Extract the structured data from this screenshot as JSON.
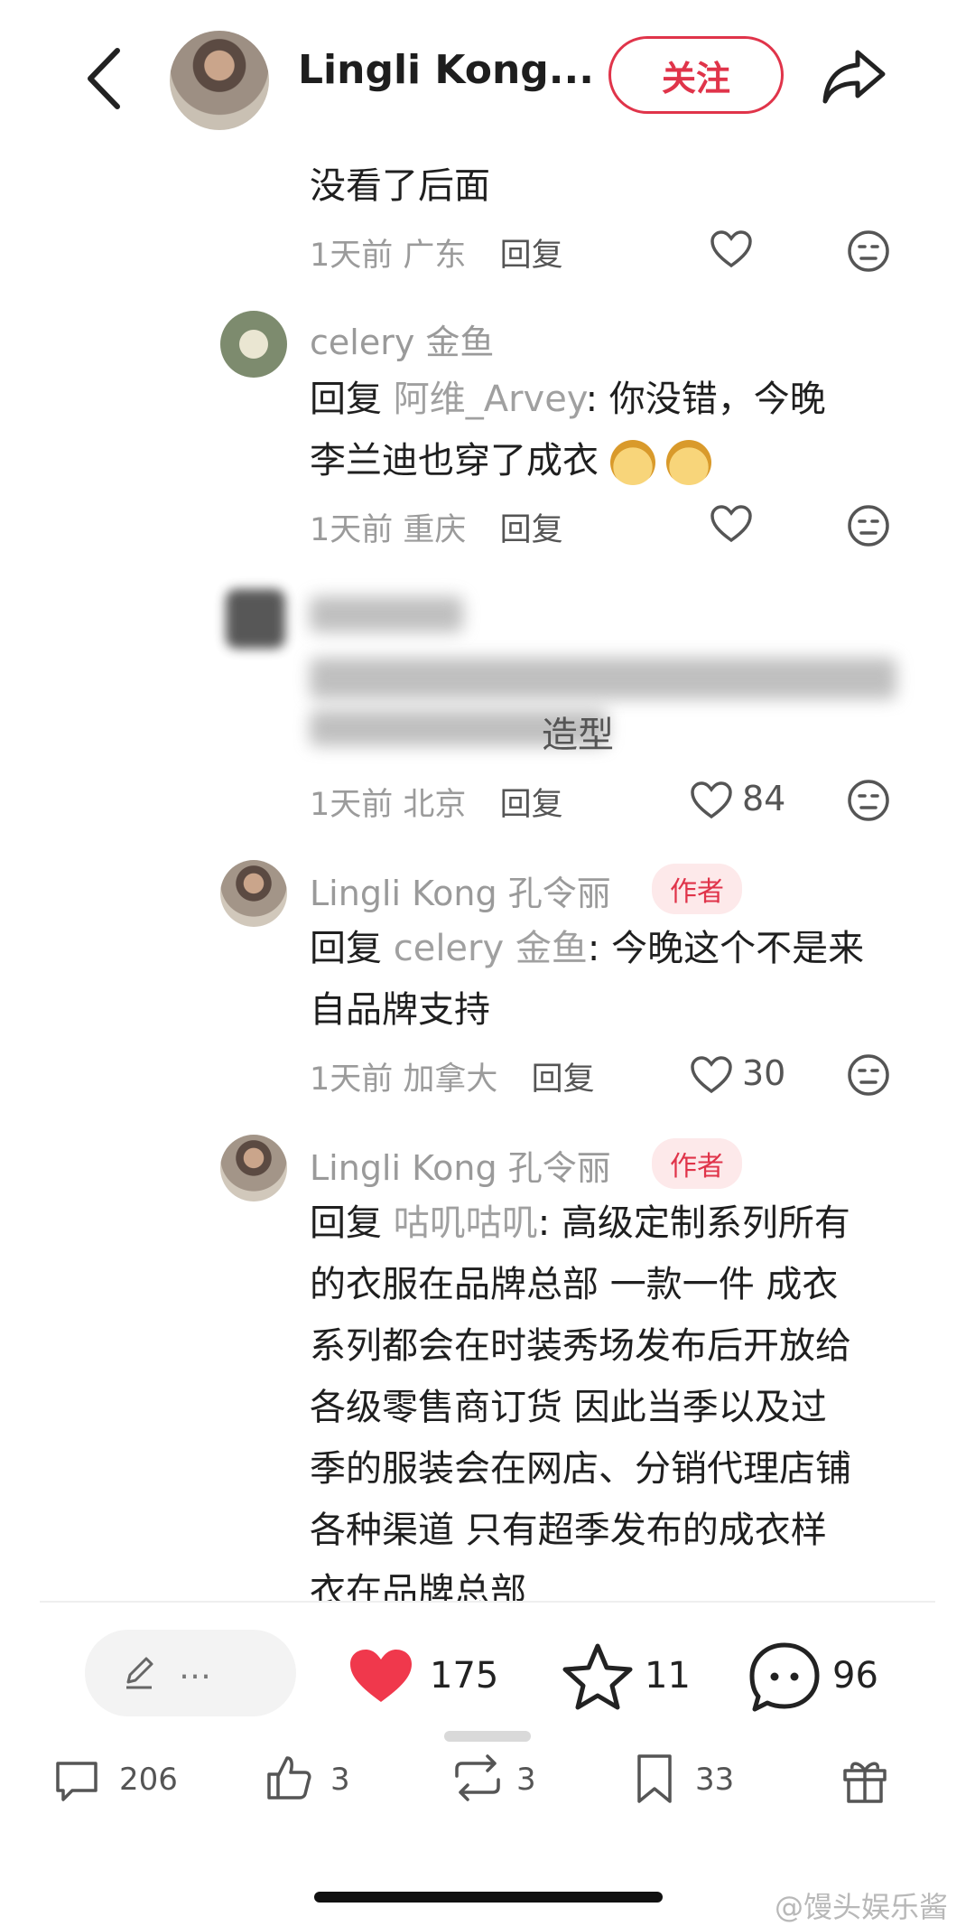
{
  "header": {
    "username": "Lingli Kong...",
    "follow_label": "关注"
  },
  "comments": [
    {
      "text": "没看了后面",
      "time": "1天前",
      "location": "广东",
      "reply_label": "回复"
    },
    {
      "username": "celery 金鱼",
      "reply_prefix": "回复",
      "mention": "阿维_Arvey",
      "text_line1": ": 你没错，今晚",
      "text_line2": "李兰迪也穿了成衣",
      "time": "1天前",
      "location": "重庆",
      "reply_label": "回复"
    },
    {
      "text_tail": "造型",
      "time": "1天前",
      "location": "北京",
      "reply_label": "回复",
      "likes": "84"
    },
    {
      "username": "Lingli Kong 孔令丽",
      "badge": "作者",
      "reply_prefix": "回复",
      "mention": "celery 金鱼",
      "text_line1": ": 今晚这个不是来",
      "text_line2": "自品牌支持",
      "time": "1天前",
      "location": "加拿大",
      "reply_label": "回复",
      "likes": "30"
    },
    {
      "username": "Lingli Kong 孔令丽",
      "badge": "作者",
      "reply_prefix": "回复",
      "mention": "咕叽咕叽",
      "text_line1": ": 高级定制系列所有",
      "lines": [
        "的衣服在品牌总部 一款一件 成衣",
        "系列都会在时装秀场发布后开放给",
        "各级零售商订货 因此当季以及过",
        "季的服装会在网店、分销代理店铺",
        "各种渠道 只有超季发布的成衣样",
        "衣在品牌总部"
      ]
    }
  ],
  "action_bar": {
    "edit_placeholder": "…",
    "likes": "175",
    "stars": "11",
    "comments": "96"
  },
  "bottom_bar": {
    "comments": "206",
    "likes": "3",
    "reposts": "3",
    "saves": "33"
  },
  "watermark": "@馒头娱乐酱",
  "colors": {
    "accent": "#e0344a",
    "muted": "#9b9b9b"
  }
}
